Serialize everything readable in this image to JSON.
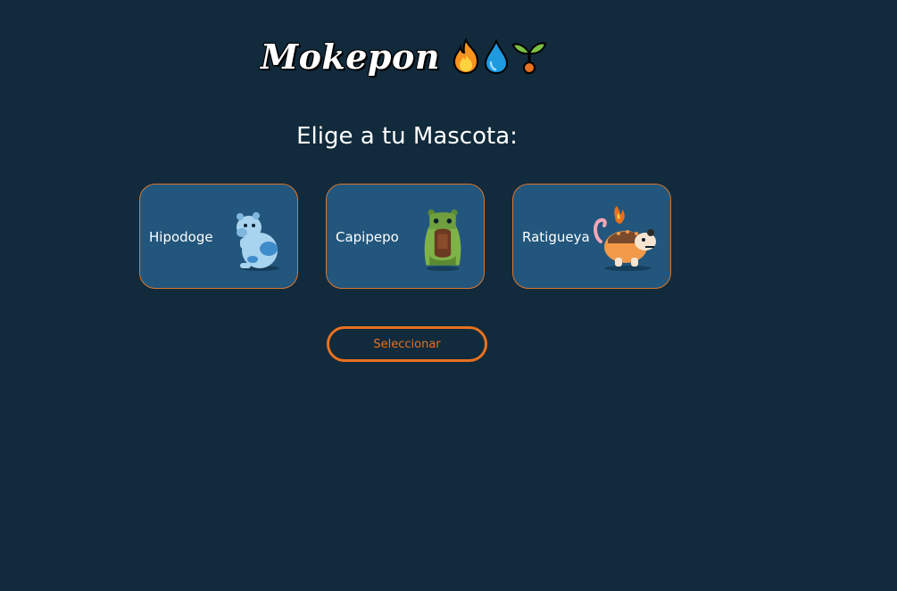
{
  "header": {
    "title": "Mokepon",
    "icons": [
      "fire-emoji",
      "droplet-emoji",
      "seedling-emoji"
    ]
  },
  "main": {
    "prompt": "Elige a tu Mascota:",
    "pets": [
      {
        "name": "Hipodoge",
        "icon": "hipodoge-creature-icon"
      },
      {
        "name": "Capipepo",
        "icon": "capipepo-creature-icon"
      },
      {
        "name": "Ratigueya",
        "icon": "ratigueya-creature-icon"
      }
    ],
    "select_label": "Seleccionar"
  },
  "colors": {
    "background": "#112a3c",
    "card": "#22567c",
    "accent": "#e8711f"
  }
}
